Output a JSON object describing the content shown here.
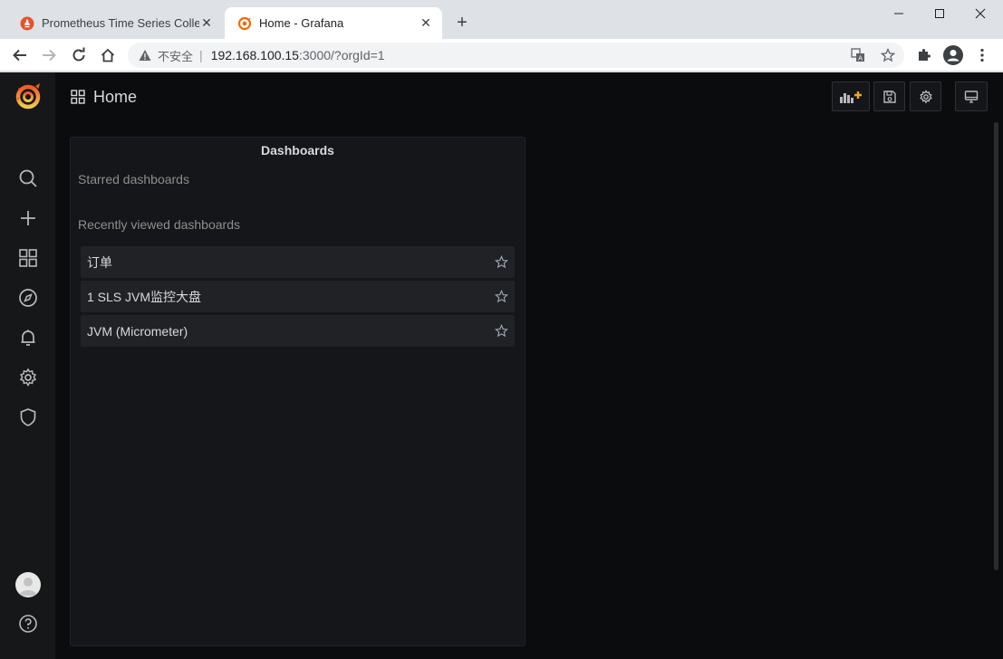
{
  "browser": {
    "tabs": [
      {
        "title": "Prometheus Time Series Collection",
        "active": false
      },
      {
        "title": "Home - Grafana",
        "active": true
      }
    ],
    "new_tab": "+",
    "address": {
      "security_label": "不安全",
      "separator": "|",
      "host": "192.168.100.15",
      "path": ":3000/?orgId=1"
    }
  },
  "grafana": {
    "page_title": "Home",
    "panel": {
      "title": "Dashboards",
      "starred_heading": "Starred dashboards",
      "recent_heading": "Recently viewed dashboards",
      "recent_items": [
        {
          "name": "订单"
        },
        {
          "name": "1 SLS JVM监控大盘"
        },
        {
          "name": "JVM (Micrometer)"
        }
      ]
    }
  },
  "colors": {
    "grafana_orange": "#f46800",
    "background": "#0b0c0e",
    "sidemenu": "#161719",
    "panel": "#141619"
  },
  "icons": {
    "sidemenu": [
      "grafana-logo-icon",
      "search-icon",
      "plus-icon",
      "dashboards-icon",
      "explore-icon",
      "alerting-icon",
      "configuration-icon",
      "server-admin-shield-icon",
      "user-avatar",
      "help-icon"
    ],
    "toolbar": [
      "add-panel-icon",
      "save-dashboard-icon",
      "settings-icon",
      "tv-mode-icon"
    ]
  }
}
